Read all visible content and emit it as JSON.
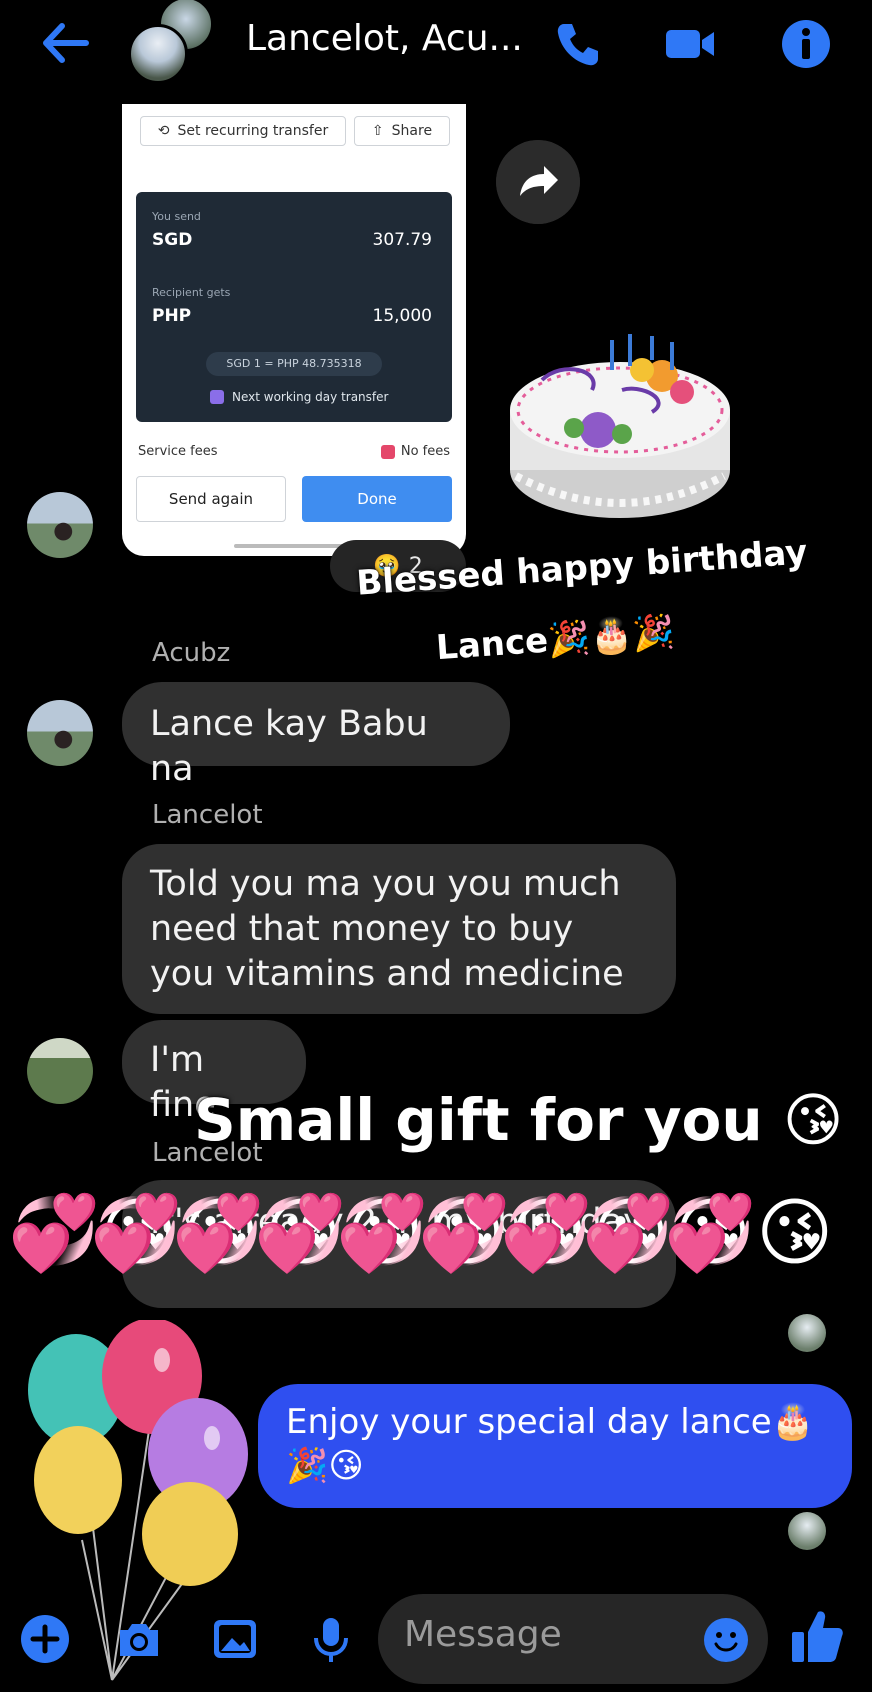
{
  "header": {
    "title": "Lancelot, Acu...",
    "accent": "#2f78f6"
  },
  "receipt": {
    "recurring_label": "Set recurring transfer",
    "share_label": "Share",
    "send_label": "You send",
    "send_currency": "SGD",
    "send_amount": "307.79",
    "gets_label": "Recipient gets",
    "gets_currency": "PHP",
    "gets_amount": "15,000",
    "rate": "SGD 1 = PHP 48.735318",
    "next_day": "Next working day transfer",
    "fees_label": "Service fees",
    "fees_value": "No fees",
    "send_again": "Send again",
    "done": "Done"
  },
  "reaction": {
    "emoji": "🥹",
    "count": "2"
  },
  "overlays": {
    "birthday_line1": "Blessed happy birthday",
    "birthday_line2": "Lance🎉🎂🎉",
    "gift": "Small gift for you 😘",
    "kiss_emoji": "💞😘"
  },
  "messages": [
    {
      "sender": "Acubz",
      "text": "Lance kay Babu na"
    },
    {
      "sender": "Lancelot",
      "text": "Told you ma you you much need that money to buy you vitamins and medicine"
    },
    {
      "sender": "",
      "text": "I'm fine"
    },
    {
      "sender": "Lancelot",
      "text": "It's already 2 in my birthday"
    }
  ],
  "my_message": "Enjoy your special day lance🎂🎉😘",
  "composer": {
    "placeholder": "Message"
  }
}
